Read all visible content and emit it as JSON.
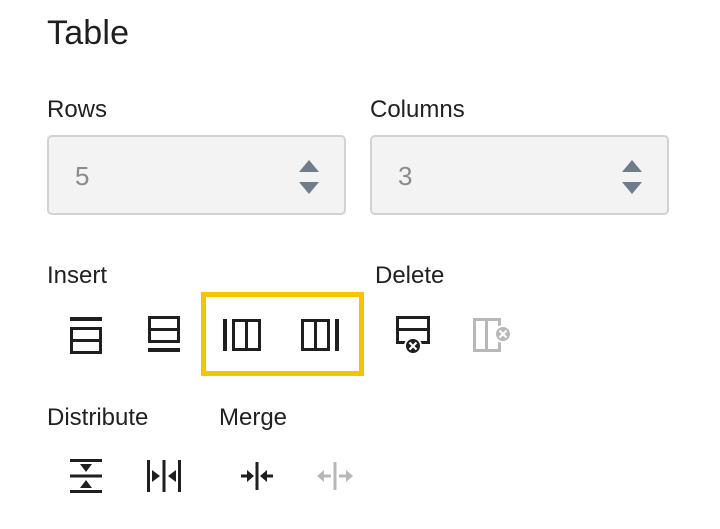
{
  "panel": {
    "title": "Table",
    "rows": {
      "label": "Rows",
      "value": "5"
    },
    "columns": {
      "label": "Columns",
      "value": "3"
    },
    "insert": {
      "label": "Insert",
      "buttons": [
        "insert-row-above-icon",
        "insert-row-below-icon",
        "insert-column-left-icon",
        "insert-column-right-icon"
      ]
    },
    "delete": {
      "label": "Delete",
      "buttons": [
        "delete-row-icon",
        "delete-column-icon"
      ]
    },
    "distribute": {
      "label": "Distribute",
      "buttons": [
        "distribute-rows-icon",
        "distribute-columns-icon"
      ]
    },
    "merge": {
      "label": "Merge",
      "buttons": [
        "merge-cells-icon",
        "split-cells-icon"
      ]
    }
  },
  "colors": {
    "highlight": "#f5c400",
    "icon": "#1f1f1f",
    "disabled": "#b8b8b8",
    "input_bg": "#f3f3f3",
    "input_border": "#d2d2d2"
  }
}
